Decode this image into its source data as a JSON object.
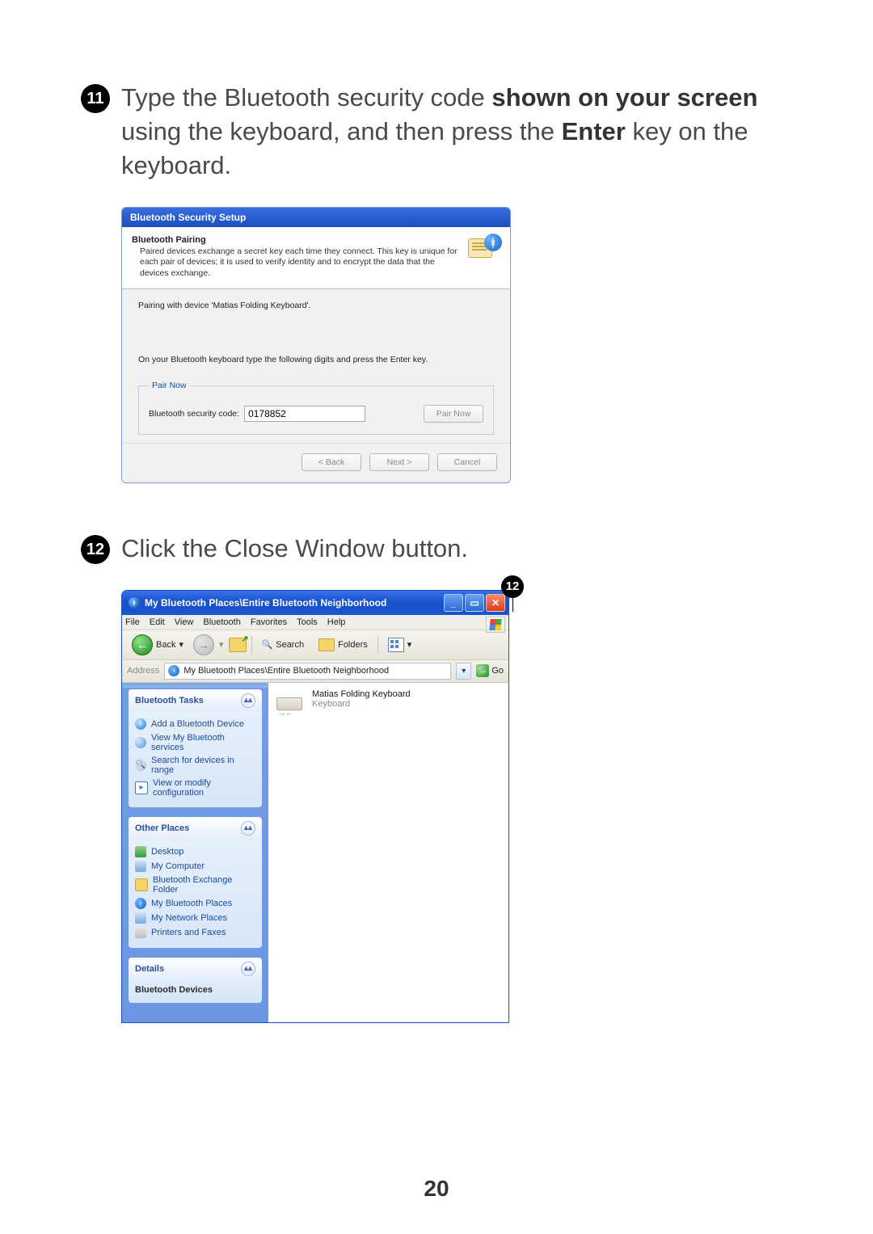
{
  "page_number": "20",
  "steps": {
    "s11": {
      "num": "11",
      "t1": "Type the Bluetooth security code ",
      "t2": "shown on your screen",
      "t3": " using the keyboard, and then press the ",
      "t4": "Enter",
      "t5": " key on the keyboard."
    },
    "s12": {
      "num": "12",
      "t1": "Click the Close Window button.",
      "callout": "12"
    }
  },
  "dialog1": {
    "title": "Bluetooth Security Setup",
    "h": "Bluetooth Pairing",
    "sub": "Paired devices exchange a secret key each time they connect. This key is unique for each pair of devices; it is used to verify identity and to encrypt the data that the devices exchange.",
    "line1": "Pairing with device 'Matias Folding Keyboard'.",
    "instr": "On your Bluetooth keyboard type the following digits and press the Enter key.",
    "legend": "Pair Now",
    "sec_label": "Bluetooth security code:",
    "code": "0178852",
    "btn_pair": "Pair Now",
    "btn_back": "< Back",
    "btn_next": "Next >",
    "btn_cancel": "Cancel"
  },
  "explorer": {
    "title": "My Bluetooth Places\\Entire Bluetooth Neighborhood",
    "menu": {
      "file": "File",
      "edit": "Edit",
      "view": "View",
      "bt": "Bluetooth",
      "fav": "Favorites",
      "tools": "Tools",
      "help": "Help"
    },
    "toolbar": {
      "back": "Back",
      "search": "Search",
      "folders": "Folders"
    },
    "sysbtn": {
      "min": "_",
      "max": "▭",
      "close": "✕"
    },
    "dropdown_arrow": "▾",
    "fwd_arrow": "→",
    "back_arrow": "←",
    "chevron": "▴▴",
    "addr": {
      "label": "Address",
      "value": "My Bluetooth Places\\Entire Bluetooth Neighborhood",
      "go": "Go",
      "go_arrow": "→",
      "drop": "▾"
    },
    "panels": {
      "tasks": {
        "title": "Bluetooth Tasks",
        "items": [
          "Add a Bluetooth Device",
          "View My Bluetooth services",
          "Search for devices in range",
          "View or modify configuration"
        ]
      },
      "places": {
        "title": "Other Places",
        "items": [
          "Desktop",
          "My Computer",
          "Bluetooth Exchange Folder",
          "My Bluetooth Places",
          "My Network Places",
          "Printers and Faxes"
        ]
      },
      "details": {
        "title": "Details",
        "sub": "Bluetooth Devices"
      }
    },
    "device": {
      "name": "Matias Folding Keyboard",
      "sub": "Keyboard",
      "arrows": "→←"
    }
  },
  "glyphs": {
    "bt_rune": "ᚼ",
    "mag": "🔍"
  }
}
